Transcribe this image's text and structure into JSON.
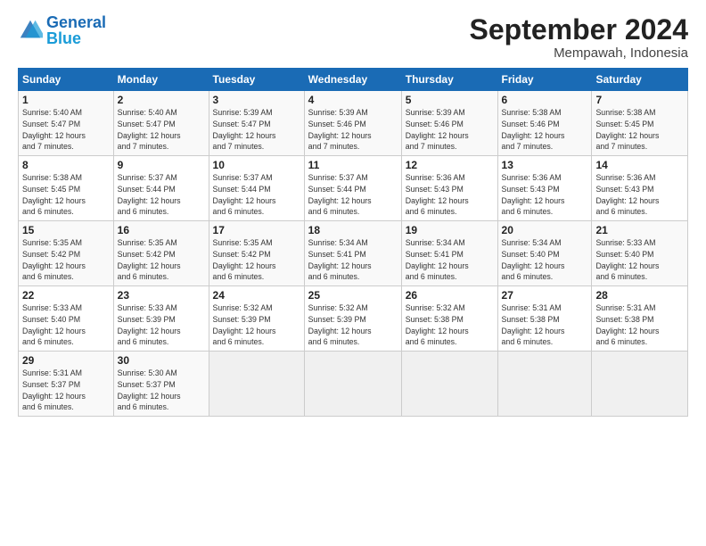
{
  "header": {
    "logo_general": "General",
    "logo_blue": "Blue",
    "month_title": "September 2024",
    "location": "Mempawah, Indonesia"
  },
  "days_of_week": [
    "Sunday",
    "Monday",
    "Tuesday",
    "Wednesday",
    "Thursday",
    "Friday",
    "Saturday"
  ],
  "weeks": [
    [
      {
        "day": "1",
        "info": "Sunrise: 5:40 AM\nSunset: 5:47 PM\nDaylight: 12 hours\nand 7 minutes."
      },
      {
        "day": "2",
        "info": "Sunrise: 5:40 AM\nSunset: 5:47 PM\nDaylight: 12 hours\nand 7 minutes."
      },
      {
        "day": "3",
        "info": "Sunrise: 5:39 AM\nSunset: 5:47 PM\nDaylight: 12 hours\nand 7 minutes."
      },
      {
        "day": "4",
        "info": "Sunrise: 5:39 AM\nSunset: 5:46 PM\nDaylight: 12 hours\nand 7 minutes."
      },
      {
        "day": "5",
        "info": "Sunrise: 5:39 AM\nSunset: 5:46 PM\nDaylight: 12 hours\nand 7 minutes."
      },
      {
        "day": "6",
        "info": "Sunrise: 5:38 AM\nSunset: 5:46 PM\nDaylight: 12 hours\nand 7 minutes."
      },
      {
        "day": "7",
        "info": "Sunrise: 5:38 AM\nSunset: 5:45 PM\nDaylight: 12 hours\nand 7 minutes."
      }
    ],
    [
      {
        "day": "8",
        "info": "Sunrise: 5:38 AM\nSunset: 5:45 PM\nDaylight: 12 hours\nand 6 minutes."
      },
      {
        "day": "9",
        "info": "Sunrise: 5:37 AM\nSunset: 5:44 PM\nDaylight: 12 hours\nand 6 minutes."
      },
      {
        "day": "10",
        "info": "Sunrise: 5:37 AM\nSunset: 5:44 PM\nDaylight: 12 hours\nand 6 minutes."
      },
      {
        "day": "11",
        "info": "Sunrise: 5:37 AM\nSunset: 5:44 PM\nDaylight: 12 hours\nand 6 minutes."
      },
      {
        "day": "12",
        "info": "Sunrise: 5:36 AM\nSunset: 5:43 PM\nDaylight: 12 hours\nand 6 minutes."
      },
      {
        "day": "13",
        "info": "Sunrise: 5:36 AM\nSunset: 5:43 PM\nDaylight: 12 hours\nand 6 minutes."
      },
      {
        "day": "14",
        "info": "Sunrise: 5:36 AM\nSunset: 5:43 PM\nDaylight: 12 hours\nand 6 minutes."
      }
    ],
    [
      {
        "day": "15",
        "info": "Sunrise: 5:35 AM\nSunset: 5:42 PM\nDaylight: 12 hours\nand 6 minutes."
      },
      {
        "day": "16",
        "info": "Sunrise: 5:35 AM\nSunset: 5:42 PM\nDaylight: 12 hours\nand 6 minutes."
      },
      {
        "day": "17",
        "info": "Sunrise: 5:35 AM\nSunset: 5:42 PM\nDaylight: 12 hours\nand 6 minutes."
      },
      {
        "day": "18",
        "info": "Sunrise: 5:34 AM\nSunset: 5:41 PM\nDaylight: 12 hours\nand 6 minutes."
      },
      {
        "day": "19",
        "info": "Sunrise: 5:34 AM\nSunset: 5:41 PM\nDaylight: 12 hours\nand 6 minutes."
      },
      {
        "day": "20",
        "info": "Sunrise: 5:34 AM\nSunset: 5:40 PM\nDaylight: 12 hours\nand 6 minutes."
      },
      {
        "day": "21",
        "info": "Sunrise: 5:33 AM\nSunset: 5:40 PM\nDaylight: 12 hours\nand 6 minutes."
      }
    ],
    [
      {
        "day": "22",
        "info": "Sunrise: 5:33 AM\nSunset: 5:40 PM\nDaylight: 12 hours\nand 6 minutes."
      },
      {
        "day": "23",
        "info": "Sunrise: 5:33 AM\nSunset: 5:39 PM\nDaylight: 12 hours\nand 6 minutes."
      },
      {
        "day": "24",
        "info": "Sunrise: 5:32 AM\nSunset: 5:39 PM\nDaylight: 12 hours\nand 6 minutes."
      },
      {
        "day": "25",
        "info": "Sunrise: 5:32 AM\nSunset: 5:39 PM\nDaylight: 12 hours\nand 6 minutes."
      },
      {
        "day": "26",
        "info": "Sunrise: 5:32 AM\nSunset: 5:38 PM\nDaylight: 12 hours\nand 6 minutes."
      },
      {
        "day": "27",
        "info": "Sunrise: 5:31 AM\nSunset: 5:38 PM\nDaylight: 12 hours\nand 6 minutes."
      },
      {
        "day": "28",
        "info": "Sunrise: 5:31 AM\nSunset: 5:38 PM\nDaylight: 12 hours\nand 6 minutes."
      }
    ],
    [
      {
        "day": "29",
        "info": "Sunrise: 5:31 AM\nSunset: 5:37 PM\nDaylight: 12 hours\nand 6 minutes."
      },
      {
        "day": "30",
        "info": "Sunrise: 5:30 AM\nSunset: 5:37 PM\nDaylight: 12 hours\nand 6 minutes."
      },
      {
        "day": "",
        "info": ""
      },
      {
        "day": "",
        "info": ""
      },
      {
        "day": "",
        "info": ""
      },
      {
        "day": "",
        "info": ""
      },
      {
        "day": "",
        "info": ""
      }
    ]
  ]
}
